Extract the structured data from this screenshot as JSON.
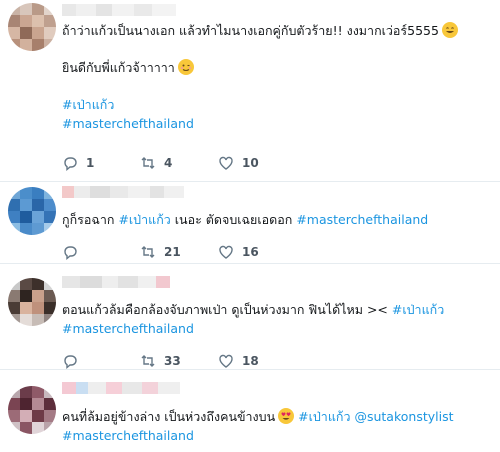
{
  "tweets": [
    {
      "lines": [
        {
          "parts": [
            {
              "t": "ถ้าว่าแก้วเป็นนางเอก แล้วทำไมนางเอกคู่กับตัวร้าย!! งงมากเว่อร์5555",
              "k": "text"
            }
          ],
          "emoji": "smile"
        },
        {
          "parts": [],
          "emoji": null
        },
        {
          "parts": [
            {
              "t": "ยินดีกับพี่แก้วจ้าาาาา",
              "k": "text"
            }
          ],
          "emoji": "wink"
        },
        {
          "parts": [],
          "emoji": null
        },
        {
          "parts": [
            {
              "t": "#เป่าแก้ว",
              "k": "hashtag"
            }
          ],
          "emoji": null
        },
        {
          "parts": [
            {
              "t": "#masterchefthailand",
              "k": "hashtag"
            }
          ],
          "emoji": null
        }
      ],
      "replies": "1",
      "retweets": "4",
      "likes": "10"
    },
    {
      "lines": [
        {
          "parts": [
            {
              "t": "กูก็รอฉาก ",
              "k": "text"
            },
            {
              "t": "#เป่าแก้ว",
              "k": "hashtag"
            },
            {
              "t": " เนอะ ตัดจบเฉยเอดอก ",
              "k": "text"
            },
            {
              "t": "#masterchefthailand",
              "k": "hashtag"
            }
          ],
          "emoji": null
        }
      ],
      "replies": "",
      "retweets": "21",
      "likes": "16"
    },
    {
      "lines": [
        {
          "parts": [
            {
              "t": "ตอนแก้วล้มคือกล้องจับภาพเป่า ดูเป็นห่วงมาก ฟินได้ไหม >< ",
              "k": "text"
            },
            {
              "t": "#เป่าแก้ว",
              "k": "hashtag"
            }
          ],
          "emoji": null
        },
        {
          "parts": [
            {
              "t": "#masterchefthailand",
              "k": "hashtag"
            }
          ],
          "emoji": null
        }
      ],
      "replies": "",
      "retweets": "33",
      "likes": "18"
    },
    {
      "lines": [
        {
          "parts": [
            {
              "t": "คนที่ล้มอยู่ข้างล่าง เป็นห่วงถึงคนข้างบน",
              "k": "text"
            }
          ],
          "emoji": "heart-eyes",
          "after": [
            {
              "t": " #เป่าแก้ว",
              "k": "hashtag"
            },
            {
              "t": " @sutakonstylist",
              "k": "mention"
            }
          ]
        },
        {
          "parts": [
            {
              "t": "#masterchefthailand",
              "k": "hashtag"
            }
          ],
          "emoji": null
        }
      ],
      "replies": "",
      "retweets": "",
      "likes": ""
    }
  ],
  "icons": {
    "reply": "reply-icon",
    "retweet": "retweet-icon",
    "like": "heart-icon"
  },
  "colors": {
    "hashtag": "#1b95e0",
    "text": "#14171a",
    "meta": "#657786",
    "divider": "#e6ecf0"
  }
}
